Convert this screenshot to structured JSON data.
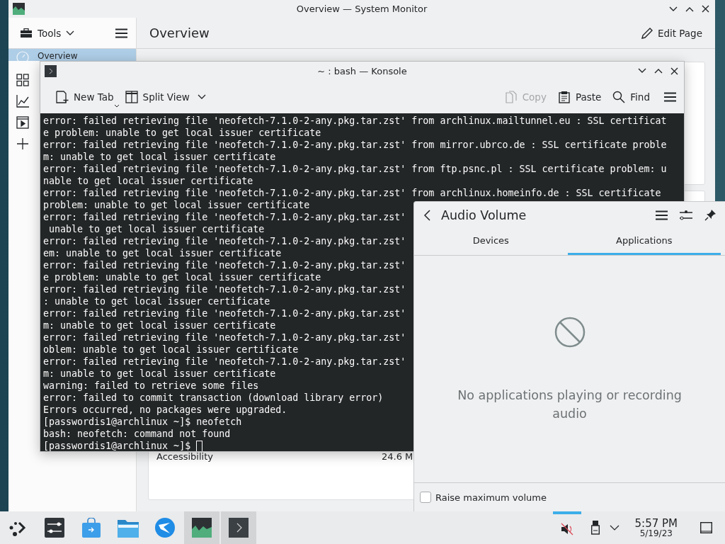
{
  "system_monitor": {
    "title": "Overview — System Monitor",
    "tools_button": "Tools",
    "sidebar_items": [
      {
        "label": "Overview",
        "selected": true
      },
      {
        "selected": false
      },
      {
        "selected": false
      },
      {
        "selected": false
      },
      {
        "selected": false
      }
    ],
    "page_title": "Overview",
    "edit_button": "Edit Page",
    "table_rows": [
      {
        "name": "Accessibility",
        "value": "24.6 M"
      }
    ]
  },
  "konsole": {
    "title": "~ : bash — Konsole",
    "toolbar": [
      {
        "kind": "new-tab",
        "label": "New Tab",
        "disabled": false
      },
      {
        "kind": "split-view",
        "label": "Split View",
        "disabled": false
      },
      {
        "kind": "copy",
        "label": "Copy",
        "disabled": true
      },
      {
        "kind": "paste",
        "label": "Paste",
        "disabled": false
      },
      {
        "kind": "find",
        "label": "Find",
        "disabled": false
      }
    ],
    "lines": [
      "error: failed retrieving file 'neofetch-7.1.0-2-any.pkg.tar.zst' from archlinux.mailtunnel.eu : SSL certificat",
      "e problem: unable to get local issuer certificate",
      "error: failed retrieving file 'neofetch-7.1.0-2-any.pkg.tar.zst' from mirror.ubrco.de : SSL certificate proble",
      "m: unable to get local issuer certificate",
      "error: failed retrieving file 'neofetch-7.1.0-2-any.pkg.tar.zst' from ftp.psnc.pl : SSL certificate problem: u",
      "nable to get local issuer certificate",
      "error: failed retrieving file 'neofetch-7.1.0-2-any.pkg.tar.zst' from archlinux.homeinfo.de : SSL certificate",
      "problem: unable to get local issuer certificate",
      "error: failed retrieving file 'neofetch-7.1.0-2-any.pkg.tar.zst'",
      " unable to get local issuer certificate",
      "error: failed retrieving file 'neofetch-7.1.0-2-any.pkg.tar.zst'",
      "em: unable to get local issuer certificate",
      "error: failed retrieving file 'neofetch-7.1.0-2-any.pkg.tar.zst'",
      "e problem: unable to get local issuer certificate",
      "error: failed retrieving file 'neofetch-7.1.0-2-any.pkg.tar.zst'",
      ": unable to get local issuer certificate",
      "error: failed retrieving file 'neofetch-7.1.0-2-any.pkg.tar.zst'",
      "m: unable to get local issuer certificate",
      "error: failed retrieving file 'neofetch-7.1.0-2-any.pkg.tar.zst'",
      "oblem: unable to get local issuer certificate",
      "error: failed retrieving file 'neofetch-7.1.0-2-any.pkg.tar.zst'",
      "m: unable to get local issuer certificate",
      "warning: failed to retrieve some files",
      "error: failed to commit transaction (download library error)",
      "Errors occurred, no packages were upgraded.",
      "[passwordis1@archlinux ~]$ neofetch",
      "bash: neofetch: command not found",
      "[passwordis1@archlinux ~]$"
    ]
  },
  "audio_popup": {
    "title": "Audio Volume",
    "tabs": [
      {
        "label": "Devices",
        "selected": false
      },
      {
        "label": "Applications",
        "selected": true
      }
    ],
    "empty_message": "No applications playing or recording audio",
    "raise_volume": {
      "label": "Raise maximum volume",
      "checked": false
    }
  },
  "taskbar": {
    "tasks": [
      {
        "kind": "launcher",
        "active": false
      },
      {
        "kind": "settings",
        "active": false
      },
      {
        "kind": "store",
        "active": false
      },
      {
        "kind": "files",
        "active": false
      },
      {
        "kind": "browser",
        "active": false
      },
      {
        "kind": "monitor",
        "active": true
      },
      {
        "kind": "terminal",
        "active": true
      }
    ],
    "volume": {
      "muted": true,
      "popup_open": true
    },
    "clock": {
      "time": "5:57 PM",
      "date": "5/19/23"
    }
  }
}
